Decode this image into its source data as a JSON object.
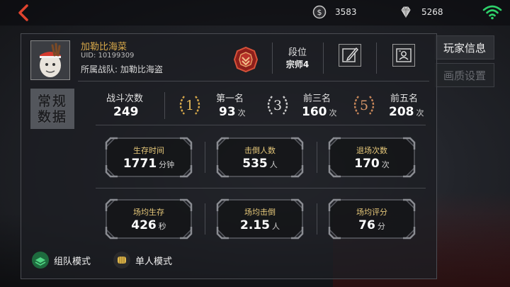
{
  "topbar": {
    "coins": "3583",
    "diamonds": "5268"
  },
  "tabs": [
    {
      "label": "玩家信息",
      "active": true
    },
    {
      "label": "画质设置",
      "active": false
    }
  ],
  "player": {
    "name": "加勒比海菜",
    "uid": "UID: 10199309",
    "team": "所属战队: 加勒比海盗",
    "rank_label": "段位",
    "rank_value": "宗师4"
  },
  "side_tab": {
    "line1": "常规",
    "line2": "数据"
  },
  "summary": {
    "battles_label": "战斗次数",
    "battles_value": "249",
    "first_label": "第一名",
    "first_value": "93",
    "top3_label": "前三名",
    "top3_value": "160",
    "top5_label": "前五名",
    "top5_value": "208",
    "unit_times": "次",
    "laurel1": "1",
    "laurel3": "3",
    "laurel5": "5"
  },
  "cards": [
    {
      "label": "生存时间",
      "value": "1771",
      "unit": "分钟"
    },
    {
      "label": "击倒人数",
      "value": "535",
      "unit": "人"
    },
    {
      "label": "退场次数",
      "value": "170",
      "unit": "次"
    },
    {
      "label": "场均生存",
      "value": "426",
      "unit": "秒"
    },
    {
      "label": "场均击倒",
      "value": "2.15",
      "unit": "人"
    },
    {
      "label": "场均评分",
      "value": "76",
      "unit": "分"
    }
  ],
  "modes": {
    "team": "组队模式",
    "solo": "单人模式"
  },
  "colors": {
    "gold": "#d7a84a",
    "silver": "#cfcfcf",
    "bronze": "#c8875a",
    "wifi": "#2fd06a",
    "back": "#e0432e"
  },
  "icons": [
    "back-arrow-icon",
    "coin-icon",
    "diamond-icon",
    "wifi-icon",
    "rank-badge-icon",
    "edit-icon",
    "id-card-icon",
    "team-mode-icon",
    "solo-mode-icon"
  ]
}
